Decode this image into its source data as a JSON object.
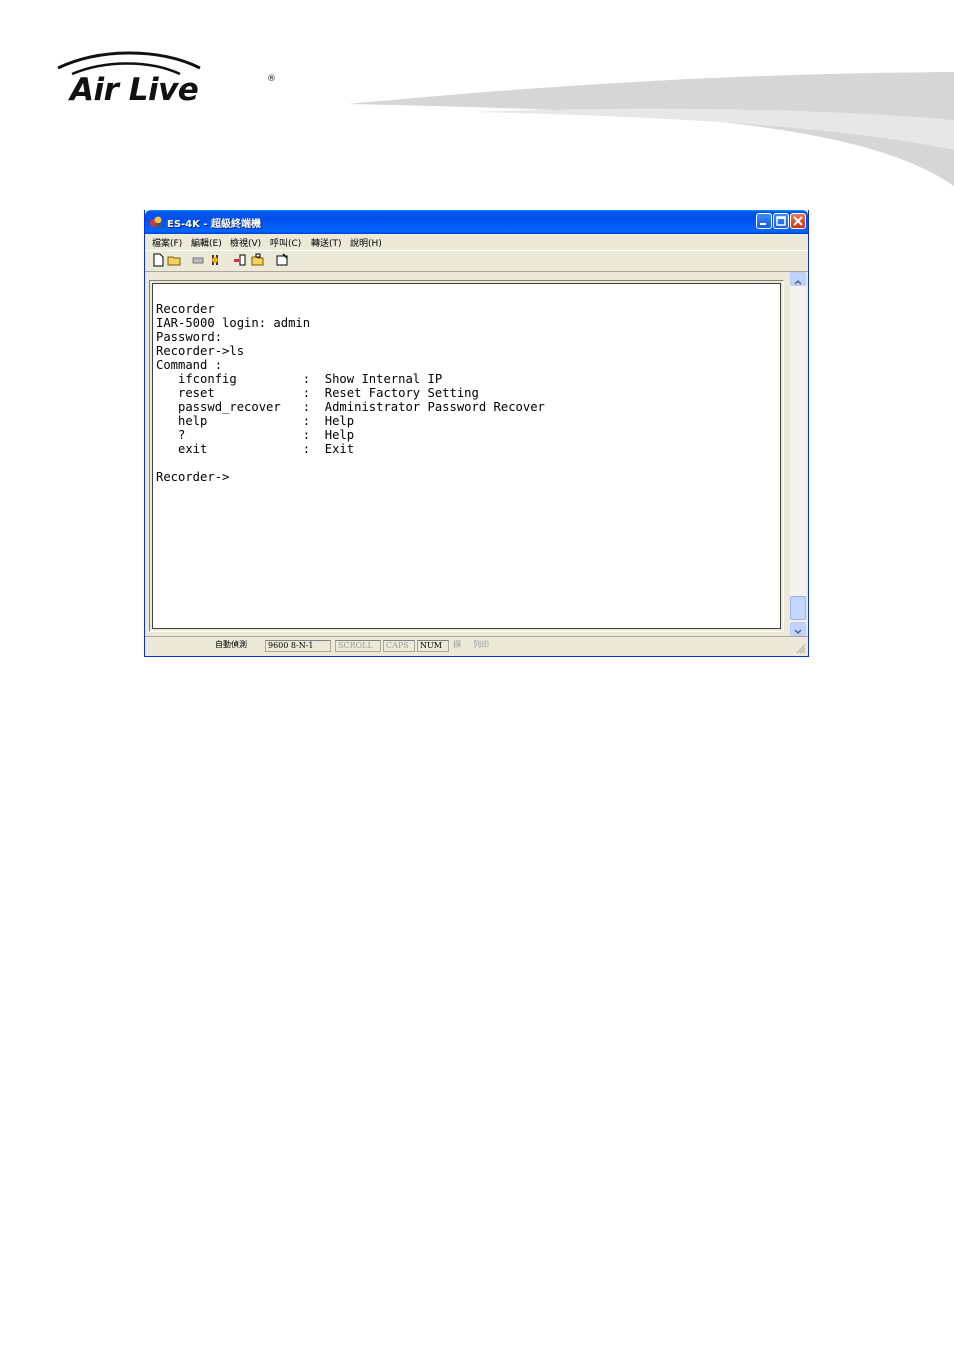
{
  "brand": {
    "logo_text": "Air Live",
    "registered_mark": "®"
  },
  "window": {
    "title": "ES-4K - 超級終端機",
    "controls": {
      "minimize": "minimize-icon",
      "maximize": "maximize-icon",
      "close": "close-icon"
    },
    "menu": [
      "檔案(F)",
      "編輯(E)",
      "檢視(V)",
      "呼叫(C)",
      "轉送(T)",
      "說明(H)"
    ],
    "toolbar_icons": [
      "new-file-icon",
      "open-folder-icon",
      "disconnect-icon",
      "connect-icon",
      "send-file-icon",
      "receive-file-icon",
      "properties-icon"
    ]
  },
  "terminal": {
    "lines": [
      "Recorder",
      "IAR-5000 login: admin",
      "Password:",
      "Recorder->ls",
      "Command :",
      "   ifconfig         :  Show Internal IP",
      "   reset            :  Reset Factory Setting",
      "   passwd_recover   :  Administrator Password Recover",
      "   help             :  Help",
      "   ?                :  Help",
      "   exit             :  Exit",
      "",
      "Recorder->"
    ]
  },
  "statusbar": {
    "detect": "自動偵測",
    "port_settings": "9600 8-N-1",
    "scroll": "SCROLL",
    "caps": "CAPS",
    "num": "NUM",
    "capture": "擷",
    "print": "列印"
  }
}
